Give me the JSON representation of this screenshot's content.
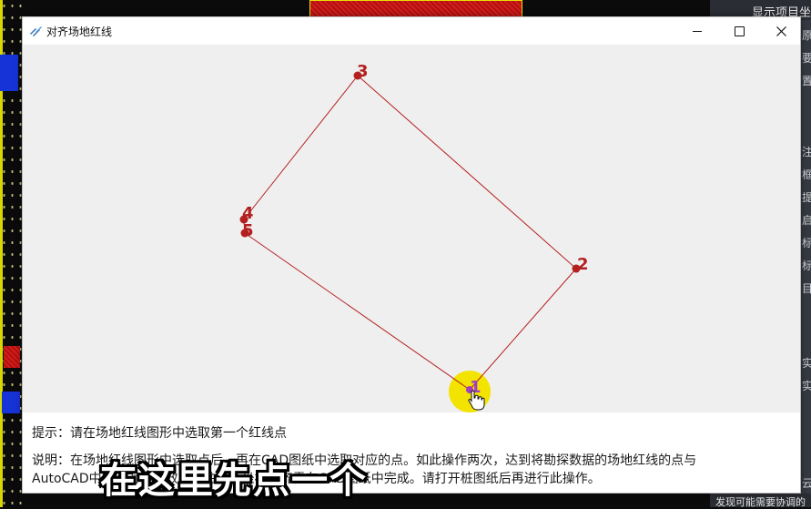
{
  "background_app": {
    "panel_title": "显示项目坐",
    "side_chars": [
      "原",
      "要",
      "置",
      "注",
      "框",
      "提",
      "启",
      "标",
      "标",
      "目",
      "实",
      "实",
      "云"
    ],
    "bottom_text": "发现可能需要协调的"
  },
  "dialog": {
    "title": "对齐场地红线",
    "buttons": {
      "minimize": "minimize",
      "maximize": "maximize",
      "close": "close"
    },
    "points": [
      {
        "label": "1",
        "state": "active"
      },
      {
        "label": "2",
        "state": "normal"
      },
      {
        "label": "3",
        "state": "normal"
      },
      {
        "label": "4",
        "state": "normal"
      },
      {
        "label": "5",
        "state": "normal"
      }
    ],
    "colors": {
      "line": "#b32020",
      "point": "#b32020",
      "active_point": "#a040c0",
      "highlight": "#f2e300"
    },
    "hint": "提示：请在场地红线图形中选取第一个红线点",
    "description_line1": "说明：在场地红线图形中选取点后，再在CAD图纸中选取对应的点。如此操作两次，达到将勘探数据的场地红线的点与",
    "description_line2": "AutoCAD中的点对齐的效果。注意，坐标对齐需在CAD图纸中完成。请打开桩图纸后再进行此操作。"
  },
  "subtitle": "在这里先点一个"
}
